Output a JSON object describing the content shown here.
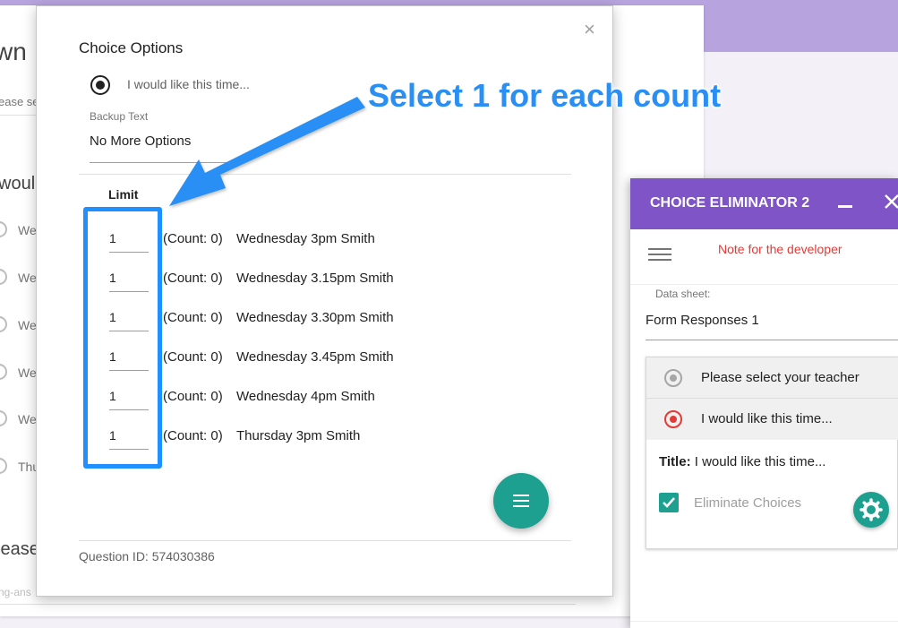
{
  "background_form": {
    "heading_fragment": "wn",
    "hint_fragment": "ease se",
    "question_fragment": "woul",
    "option_fragments": [
      "We",
      "We",
      "We",
      "We",
      "We",
      "Thu"
    ],
    "bottom_fragment": "lease",
    "bottom_hint_fragment": "ng-ans"
  },
  "dialog": {
    "title": "Choice Options",
    "close_icon": "close-icon",
    "question_text": "I would like this time...",
    "backup_label": "Backup Text",
    "backup_value": "No More Options",
    "limit_header": "Limit",
    "rows": [
      {
        "limit": "1",
        "count": "(Count: 0)",
        "label": "Wednesday 3pm Smith"
      },
      {
        "limit": "1",
        "count": "(Count: 0)",
        "label": "Wednesday 3.15pm Smith"
      },
      {
        "limit": "1",
        "count": "(Count: 0)",
        "label": "Wednesday 3.30pm Smith"
      },
      {
        "limit": "1",
        "count": "(Count: 0)",
        "label": "Wednesday 3.45pm Smith"
      },
      {
        "limit": "1",
        "count": "(Count: 0)",
        "label": "Wednesday 4pm Smith"
      },
      {
        "limit": "1",
        "count": "(Count: 0)",
        "label": "Thursday 3pm Smith"
      }
    ],
    "question_id": "Question ID: 574030386",
    "menu_fab_icon": "menu-icon"
  },
  "annotation": {
    "callout_text": "Select 1 for each count",
    "color": "#2a8ff5"
  },
  "panel": {
    "title": "CHOICE ELIMINATOR 2",
    "minimize_icon": "minimize-icon",
    "close_icon": "close-icon",
    "note": "Note for the developer",
    "data_sheet_label": "Data sheet:",
    "data_sheet_value": "Form Responses 1",
    "choices": [
      "Please select your teacher",
      "I would like this time..."
    ],
    "title_label": "Title:",
    "title_value": "I would like this time...",
    "eliminate_label": "Eliminate Choices",
    "accent_color": "#7e54c6",
    "note_color": "#e53935",
    "teal": "#1ea090"
  }
}
